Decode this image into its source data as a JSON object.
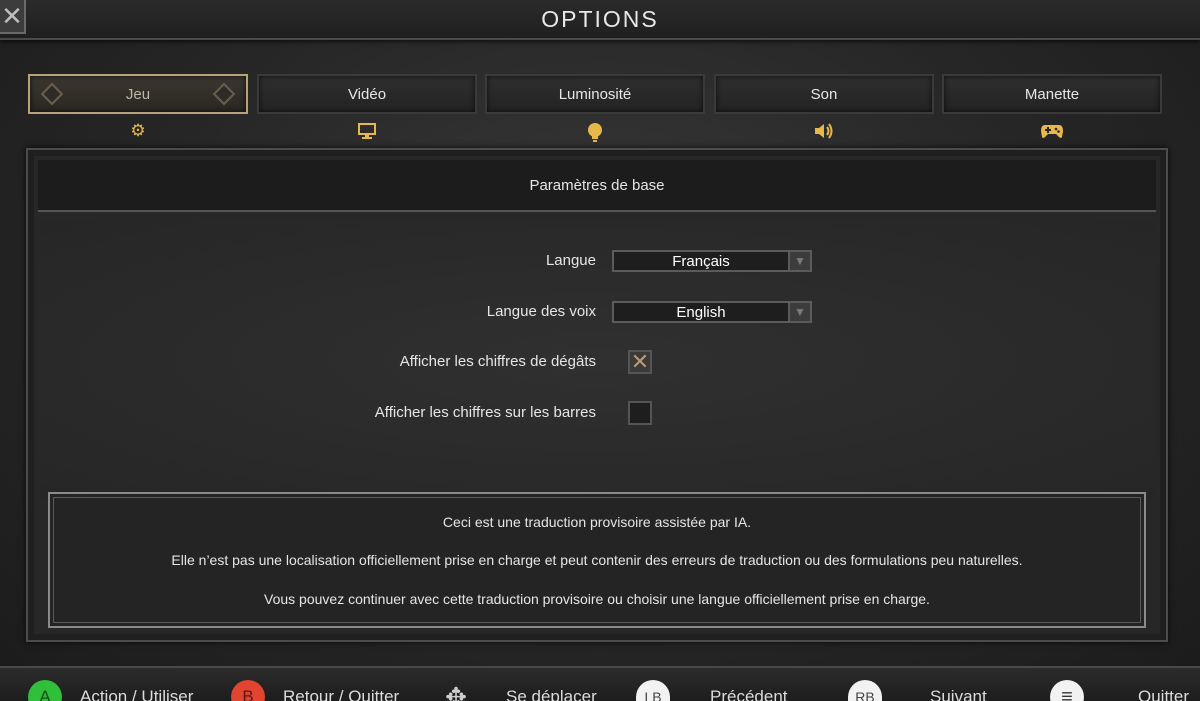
{
  "header": {
    "title": "OPTIONS",
    "close_icon": "✕"
  },
  "tabs": [
    {
      "label": "Jeu",
      "icon": "⚙",
      "icon_name": "gear-icon",
      "active": true
    },
    {
      "label": "Vidéo",
      "icon": "🖵",
      "icon_name": "monitor-icon",
      "active": false
    },
    {
      "label": "Luminosité",
      "icon": "💡",
      "icon_name": "lightbulb-icon",
      "active": false
    },
    {
      "label": "Son",
      "icon": "🔊",
      "icon_name": "speaker-icon",
      "active": false
    },
    {
      "label": "Manette",
      "icon": "🎮",
      "icon_name": "gamepad-icon",
      "active": false
    }
  ],
  "section": {
    "title": "Paramètres de base"
  },
  "settings": {
    "language": {
      "label": "Langue",
      "value": "Français"
    },
    "voice_language": {
      "label": "Langue des voix",
      "value": "English"
    },
    "damage_numbers": {
      "label": "Afficher les chiffres de dégâts",
      "checked": true,
      "mark": "✕"
    },
    "bar_numbers": {
      "label": "Afficher les chiffres sur les barres",
      "checked": false
    }
  },
  "notice": {
    "line1": "Ceci est une traduction provisoire assistée par IA.",
    "line2": "Elle n’est pas une localisation officiellement prise en charge et peut contenir des erreurs de traduction ou des formulations peu naturelles.",
    "line3": "Vous pouvez continuer avec cette traduction provisoire ou choisir une langue officiellement prise en charge."
  },
  "footer": {
    "hints": [
      {
        "glyph": "A",
        "label": "Action / Utiliser"
      },
      {
        "glyph": "B",
        "label": "Retour / Quitter"
      },
      {
        "glyph": "✥",
        "label": "Se déplacer"
      },
      {
        "glyph": "LB",
        "label": "Précédent"
      },
      {
        "glyph": "RB",
        "label": "Suivant"
      },
      {
        "glyph": "≡",
        "label": "Quitter"
      }
    ]
  },
  "colors": {
    "accent_gold": "#e6b84a",
    "active_tab_border": "#b7a27a",
    "button_a": "#2fbf3a",
    "button_b": "#e2442f"
  }
}
